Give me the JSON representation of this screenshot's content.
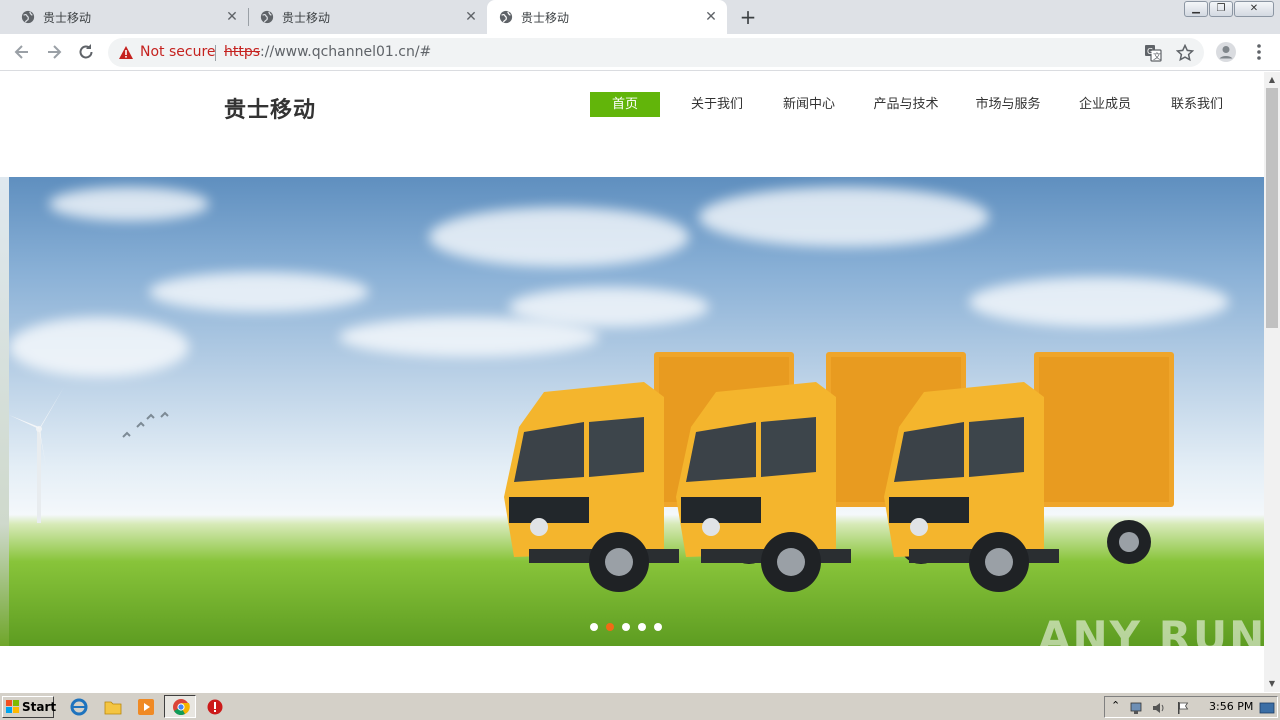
{
  "browser": {
    "tabs": [
      {
        "title": "贵士移动",
        "active": false
      },
      {
        "title": "贵士移动",
        "active": false
      },
      {
        "title": "贵士移动",
        "active": true
      }
    ],
    "security_label": "Not secure",
    "url_scheme": "https",
    "url_rest": "://www.qchannel01.cn/#"
  },
  "site": {
    "logo": "贵士移动",
    "nav": [
      {
        "label": "首页",
        "active": true
      },
      {
        "label": "关于我们",
        "active": false
      },
      {
        "label": "新闻中心",
        "active": false
      },
      {
        "label": "产品与技术",
        "active": false
      },
      {
        "label": "市场与服务",
        "active": false
      },
      {
        "label": "企业成员",
        "active": false
      },
      {
        "label": "联系我们",
        "active": false
      }
    ],
    "accent_color": "#62b50a",
    "banner": {
      "slide_count": 5,
      "current_slide": 2,
      "dot_color": "#ffffff",
      "current_dot_color": "#f26a16"
    }
  },
  "watermark": "ANY RUN",
  "taskbar": {
    "start_label": "Start",
    "clock": "3:56 PM"
  },
  "icons": [
    "globe-icon",
    "close-icon",
    "plus-icon",
    "back-icon",
    "forward-icon",
    "reload-icon",
    "warning-icon",
    "translate-icon",
    "star-icon",
    "profile-icon",
    "menu-icon",
    "ie-icon",
    "folder-icon",
    "media-player-icon",
    "chrome-icon",
    "stop-icon"
  ]
}
